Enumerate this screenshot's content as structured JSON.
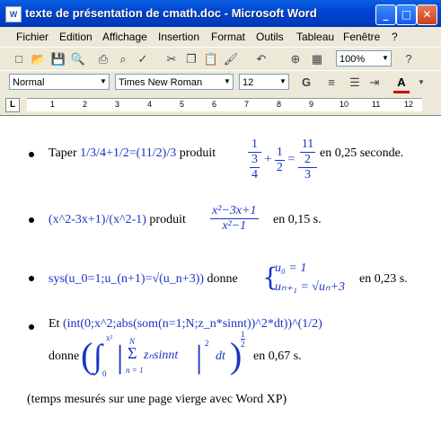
{
  "window": {
    "title": "texte de présentation de cmath.doc - Microsoft Word",
    "app_icon": "W"
  },
  "menus": [
    "Fichier",
    "Edition",
    "Affichage",
    "Insertion",
    "Format",
    "Outils",
    "Tableau",
    "Fenêtre",
    "?"
  ],
  "toolbar": {
    "zoom": "100%"
  },
  "formatting": {
    "style": "Normal",
    "font": "Times New Roman",
    "size": "12",
    "bold": "G"
  },
  "ruler": {
    "numbers": [
      "1",
      "2",
      "3",
      "4",
      "5",
      "6",
      "7",
      "8",
      "9",
      "10",
      "11",
      "12"
    ]
  },
  "document": {
    "item1": {
      "text_pre": "Taper ",
      "command": "1/3/4+1/2=(11/2)/3",
      "text_mid": " produit",
      "result": " en 0,25 seconde.",
      "m_frac1_num": "1",
      "m_frac1_den_num": "3",
      "m_frac1_den_den": "4",
      "m_plus": "+",
      "m_frac2_num": "1",
      "m_frac2_den": "2",
      "m_eq": "=",
      "m_frac3_num_num": "11",
      "m_frac3_num_den": "2",
      "m_frac3_den": "3"
    },
    "item2": {
      "command": "(x^2-3x+1)/(x^2-1)",
      "text_mid": " produit",
      "m_num": "x²−3x+1",
      "m_den": "x²−1",
      "result": " en 0,15 s."
    },
    "item3": {
      "command": "sys(u_0=1;u_(n+1)=√(u_n+3))",
      "text_mid": " donne",
      "m_line1": "u₀ = 1",
      "m_line2": "uₙ₊₁ = √uₙ+3",
      "result": " en 0,23 s."
    },
    "item4": {
      "text_pre": "Et ",
      "command": "(int(0;x^2;abs(som(n=1;N;z_n*sinnt))^2*dt))^(1/2)",
      "text_donne": "donne",
      "m_upper": "x²",
      "m_lower": "0",
      "m_sum_top": "N",
      "m_sum_bottom": "n = 1",
      "m_body": "zₙsinnt",
      "m_exp2": "2",
      "m_dt": "dt",
      "m_exp_num": "1",
      "m_exp_den": "2",
      "result": " en 0,67 s."
    },
    "footer": "(temps mesurés sur une page vierge avec Word XP)"
  }
}
